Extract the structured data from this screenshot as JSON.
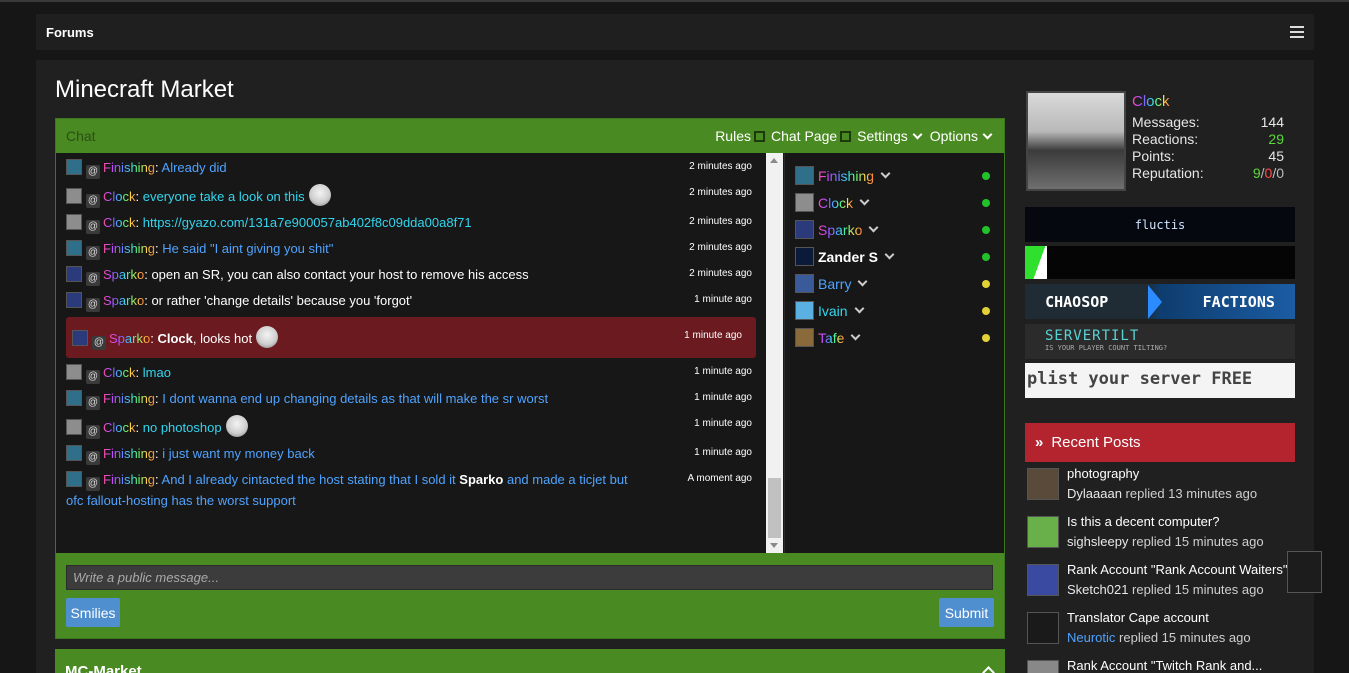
{
  "nav": {
    "forums": "Forums"
  },
  "page": {
    "title": "Minecraft Market"
  },
  "chat": {
    "title": "Chat",
    "links": {
      "rules": "Rules",
      "chat_page": "Chat Page",
      "settings": "Settings",
      "options": "Options"
    },
    "messages": [
      {
        "user": "Finishing",
        "at": "@",
        "parts": [
          {
            "text": "Already did",
            "cls": "txt-blue"
          }
        ],
        "time": "2 minutes ago"
      },
      {
        "user": "Clock",
        "at": "@",
        "parts": [
          {
            "text": "everyone take a look on this",
            "cls": "txt-cyan"
          }
        ],
        "emoji": true,
        "time": "2 minutes ago"
      },
      {
        "user": "Clock",
        "at": "@",
        "parts": [
          {
            "text": "https://gyazo.com/131a7e900057ab402f8c09dda00a8f71",
            "cls": "txt-cyan"
          }
        ],
        "time": "2 minutes ago"
      },
      {
        "user": "Finishing",
        "at": "@",
        "parts": [
          {
            "text": "He said \"I aint giving you shit\"",
            "cls": "txt-blue"
          }
        ],
        "time": "2 minutes ago"
      },
      {
        "user": "Sparko",
        "at": "@",
        "parts": [
          {
            "text": "open an SR, you can also contact your host to remove his access",
            "cls": "txt-white"
          }
        ],
        "time": "2 minutes ago"
      },
      {
        "user": "Sparko",
        "at": "@",
        "parts": [
          {
            "text": "or rather 'change details' because you 'forgot'",
            "cls": "txt-white"
          }
        ],
        "time": "1 minute ago"
      },
      {
        "user": "Sparko",
        "at": "@",
        "parts": [
          {
            "text": "Clock",
            "cls": "bold"
          },
          {
            "text": ", looks hot",
            "cls": "txt-white"
          }
        ],
        "emoji": true,
        "time": "1 minute ago",
        "highlight": true
      },
      {
        "user": "Clock",
        "at": "@",
        "parts": [
          {
            "text": "lmao",
            "cls": "txt-cyan"
          }
        ],
        "time": "1 minute ago"
      },
      {
        "user": "Finishing",
        "at": "@",
        "parts": [
          {
            "text": "I dont wanna end up changing details as that will make the sr worst",
            "cls": "txt-blue"
          }
        ],
        "time": "1 minute ago"
      },
      {
        "user": "Clock",
        "at": "@",
        "parts": [
          {
            "text": "no photoshop",
            "cls": "txt-cyan"
          }
        ],
        "emoji": true,
        "time": "1 minute ago"
      },
      {
        "user": "Finishing",
        "at": "@",
        "parts": [
          {
            "text": "i just want my money back",
            "cls": "txt-blue"
          }
        ],
        "time": "1 minute ago"
      },
      {
        "user": "Finishing",
        "at": "@",
        "parts": [
          {
            "text": "And I already cintacted the host stating that I sold it ",
            "cls": "txt-blue"
          },
          {
            "text": "Sparko",
            "cls": "bold"
          },
          {
            "text": " and made a ticjet but",
            "cls": "txt-blue"
          },
          {
            "text": "ofc fallout-hosting has the worst support",
            "cls": "txt-blue",
            "newline": true
          }
        ],
        "time": "A moment ago"
      }
    ],
    "online_users": [
      {
        "name": "Finishing",
        "style": "rainbow",
        "status": "#22c22a"
      },
      {
        "name": "Clock",
        "style": "rainbow",
        "status": "#22c22a"
      },
      {
        "name": "Sparko",
        "style": "rainbow",
        "status": "#22c22a"
      },
      {
        "name": "Zander S",
        "style": "white",
        "status": "#22c22a"
      },
      {
        "name": "Barry",
        "style": "blue",
        "status": "#e3d235"
      },
      {
        "name": "Ivain",
        "style": "cyan",
        "status": "#e3d235"
      },
      {
        "name": "Tafe",
        "style": "rainbow",
        "status": "#e3d235"
      }
    ],
    "input_placeholder": "Write a public message...",
    "smilies": "Smilies",
    "submit": "Submit"
  },
  "mc_market": {
    "title": "MC-Market"
  },
  "profile": {
    "name": "Clock",
    "messages_label": "Messages:",
    "messages": "144",
    "reactions_label": "Reactions:",
    "reactions": "29",
    "points_label": "Points:",
    "points": "45",
    "reputation_label": "Reputation:",
    "rep_pos": "9",
    "rep_sep1": "/",
    "rep_neg": "0",
    "rep_sep2": "/",
    "rep_neutral": "0"
  },
  "banners": {
    "fluctis": "fluctis",
    "chaosop": "CHAOSOP",
    "factions": "FACTIONS",
    "servertilt": "SERVERTILT",
    "servertilt_sub": "IS YOUR PLAYER COUNT TILTING?",
    "plist": "plist your server FREE"
  },
  "recent": {
    "title": "Recent Posts",
    "posts": [
      {
        "title": "photography",
        "user": "Dylaaaan",
        "meta": " replied 13 minutes ago",
        "blue": false
      },
      {
        "title": "Is this a decent computer?",
        "user": "sighsleepy",
        "meta": " replied 15 minutes ago",
        "blue": false
      },
      {
        "title": "Rank Account \"Rank Account Waiters\"",
        "user": "Sketch021",
        "meta": " replied 15 minutes ago",
        "blue": false
      },
      {
        "title": "Translator Cape account",
        "user": "Neurotic",
        "meta": " replied 15 minutes ago",
        "blue": true
      },
      {
        "title": "Rank Account \"Twitch Rank and...",
        "user": "",
        "meta": "",
        "blue": false
      }
    ]
  },
  "colors": {
    "green": "#4a8a22",
    "red": "#b3242f",
    "dark": "#202020"
  }
}
